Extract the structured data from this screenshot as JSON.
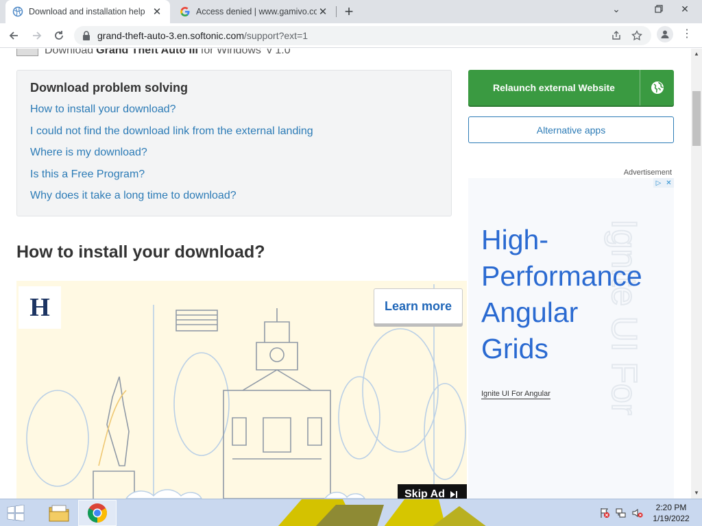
{
  "browser": {
    "tabs": [
      {
        "title": "Download and installation help",
        "active": true,
        "favicon": "softonic-globe-icon"
      },
      {
        "title": "Access denied | www.gamivo.com",
        "active": false,
        "favicon": "google-g-icon"
      }
    ],
    "new_tab": "+",
    "window_controls": {
      "minimize": "⌄",
      "restore": "▭",
      "close": "✕"
    },
    "url_host": "grand-theft-auto-3.en.softonic.com",
    "url_path": "/support?ext=1"
  },
  "page": {
    "breadcrumb": {
      "prefix": "Download",
      "program": "Grand Theft Auto III",
      "suffix": "for Windows",
      "version": "v 1.0"
    },
    "problem_solving": {
      "title": "Download problem solving",
      "links": [
        "How to install your download?",
        "I could not find the download link from the external landing",
        "Where is my download?",
        "Is this a Free Program?",
        "Why does it take a long time to download?"
      ]
    },
    "section_title": "How to install your download?",
    "relaunch_button": "Relaunch external Website",
    "alternative_apps_button": "Alternative apps",
    "advertisement_label": "Advertisement",
    "side_ad": {
      "headline_lines": [
        "High-",
        "Performance",
        "Angular",
        "Grids"
      ],
      "watermark": "Ignite UI For",
      "cta": "Ignite UI For Angular"
    },
    "video_ad": {
      "logo_letter": "H",
      "learn_more": "Learn more",
      "skip_ad": "Skip Ad"
    }
  },
  "taskbar": {
    "clock_time": "2:20 PM",
    "clock_date": "1/19/2022"
  },
  "colors": {
    "accent_green": "#3a9a41",
    "link_blue": "#2c7bb6",
    "ad_blue": "#2a6ad1"
  }
}
